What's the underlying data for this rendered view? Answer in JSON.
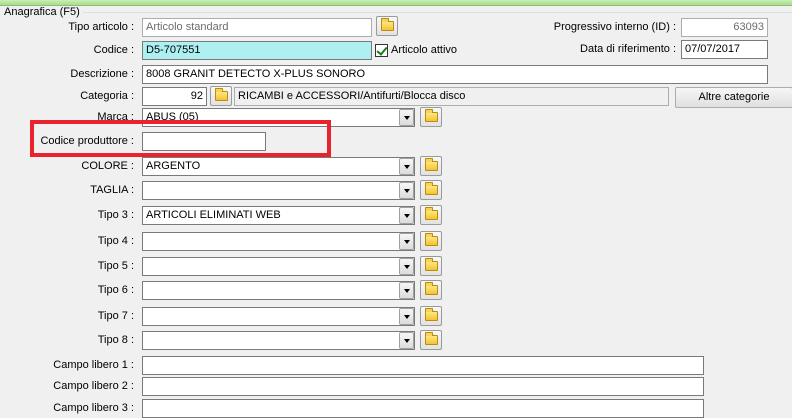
{
  "group": {
    "title": "Anagrafica (F5)"
  },
  "tipo_articolo": {
    "label": "Tipo articolo :",
    "value": "Articolo standard"
  },
  "progressivo": {
    "label": "Progressivo interno (ID) :",
    "value": "63093"
  },
  "codice": {
    "label": "Codice :",
    "value": "D5-707551"
  },
  "articolo_attivo": {
    "label": "Articolo attivo",
    "checked": true
  },
  "data_riferimento": {
    "label": "Data di riferimento :",
    "value": "07/07/2017"
  },
  "descrizione": {
    "label": "Descrizione :",
    "value": "8008 GRANIT DETECTO X-PLUS SONORO"
  },
  "categoria": {
    "label": "Categoria :",
    "code": "92",
    "name": "RICAMBI e ACCESSORI/Antifurti/Blocca disco"
  },
  "altre_categorie": {
    "label": "Altre categorie"
  },
  "marca": {
    "label": "Marca :",
    "value": "ABUS (05)"
  },
  "codice_produttore": {
    "label": "Codice produttore :",
    "value": ""
  },
  "colore": {
    "label": "COLORE :",
    "value": "ARGENTO"
  },
  "taglia": {
    "label": "TAGLIA :",
    "value": ""
  },
  "tipo3": {
    "label": "Tipo 3 :",
    "value": "ARTICOLI ELIMINATI WEB"
  },
  "tipo4": {
    "label": "Tipo 4 :",
    "value": ""
  },
  "tipo5": {
    "label": "Tipo 5 :",
    "value": ""
  },
  "tipo6": {
    "label": "Tipo 6 :",
    "value": ""
  },
  "tipo7": {
    "label": "Tipo 7 :",
    "value": ""
  },
  "tipo8": {
    "label": "Tipo 8 :",
    "value": ""
  },
  "campo_libero_1": {
    "label": "Campo libero 1 :",
    "value": ""
  },
  "campo_libero_2": {
    "label": "Campo libero 2 :",
    "value": ""
  },
  "campo_libero_3": {
    "label": "Campo libero 3 :",
    "value": ""
  },
  "colors": {
    "highlight": "#e8232b",
    "codice_bg": "#aeeff1",
    "checkmark": "#1a7a1a"
  },
  "icons": {
    "folder_button": "folder-icon",
    "dropdown": "chevron-down-icon",
    "checkbox": "checkbox-checked-icon"
  }
}
